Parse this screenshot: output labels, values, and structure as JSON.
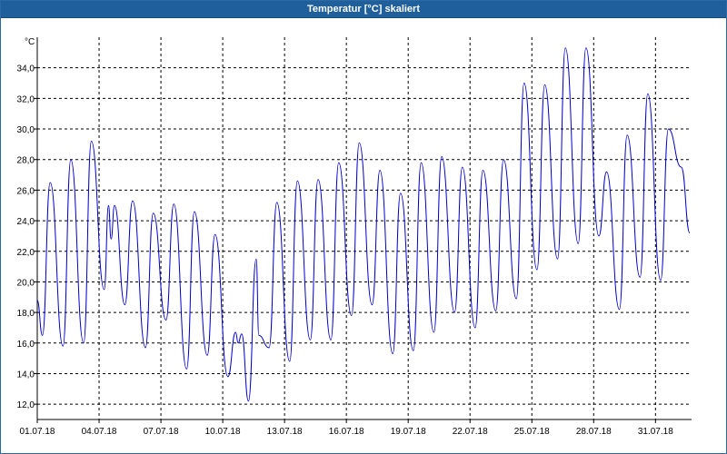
{
  "window": {
    "title": "Temperatur [°C] skaliert"
  },
  "chart_data": {
    "type": "line",
    "title": "Temperatur [°C] skaliert",
    "ylabel": "°C",
    "xlabel": "",
    "xlim": [
      "2018-07-01 00:00",
      "2018-08-01 18:00"
    ],
    "ylim": [
      11.0,
      36.0
    ],
    "grid": true,
    "line_color": "#0000cc",
    "grid_color": "#000000",
    "x_tick_labels": [
      "01.07.18",
      "04.07.18",
      "07.07.18",
      "10.07.18",
      "13.07.18",
      "16.07.18",
      "19.07.18",
      "22.07.18",
      "25.07.18",
      "28.07.18",
      "31.07.18"
    ],
    "y_tick_labels": [
      "12,0",
      "14,0",
      "16,0",
      "18,0",
      "20,0",
      "22,0",
      "24,0",
      "26,0",
      "28,0",
      "30,0",
      "32,0",
      "34,0"
    ],
    "series": [
      {
        "values": [
          [
            "2018-07-01 00:00",
            18.8
          ],
          [
            "2018-07-01 06:00",
            16.5
          ],
          [
            "2018-07-01 15:00",
            26.5
          ],
          [
            "2018-07-02 06:00",
            15.8
          ],
          [
            "2018-07-02 15:00",
            28.0
          ],
          [
            "2018-07-03 06:00",
            16.0
          ],
          [
            "2018-07-03 15:00",
            29.2
          ],
          [
            "2018-07-04 06:00",
            19.5
          ],
          [
            "2018-07-04 11:00",
            25.0
          ],
          [
            "2018-07-04 14:00",
            22.8
          ],
          [
            "2018-07-04 18:00",
            25.0
          ],
          [
            "2018-07-05 06:00",
            18.5
          ],
          [
            "2018-07-05 15:00",
            25.3
          ],
          [
            "2018-07-06 06:00",
            15.7
          ],
          [
            "2018-07-06 15:00",
            24.5
          ],
          [
            "2018-07-07 06:00",
            17.5
          ],
          [
            "2018-07-07 15:00",
            25.1
          ],
          [
            "2018-07-08 06:00",
            14.3
          ],
          [
            "2018-07-08 15:00",
            24.6
          ],
          [
            "2018-07-09 06:00",
            15.2
          ],
          [
            "2018-07-09 15:00",
            23.1
          ],
          [
            "2018-07-10 06:00",
            13.8
          ],
          [
            "2018-07-10 15:00",
            16.7
          ],
          [
            "2018-07-10 18:00",
            16.0
          ],
          [
            "2018-07-10 22:00",
            16.6
          ],
          [
            "2018-07-11 06:00",
            12.2
          ],
          [
            "2018-07-11 15:00",
            21.5
          ],
          [
            "2018-07-11 18:00",
            16.5
          ],
          [
            "2018-07-12 06:00",
            15.7
          ],
          [
            "2018-07-12 15:00",
            25.2
          ],
          [
            "2018-07-13 06:00",
            14.8
          ],
          [
            "2018-07-13 15:00",
            26.6
          ],
          [
            "2018-07-14 06:00",
            16.2
          ],
          [
            "2018-07-14 15:00",
            26.7
          ],
          [
            "2018-07-15 06:00",
            16.2
          ],
          [
            "2018-07-15 15:00",
            27.8
          ],
          [
            "2018-07-16 06:00",
            17.8
          ],
          [
            "2018-07-16 15:00",
            29.1
          ],
          [
            "2018-07-17 06:00",
            18.5
          ],
          [
            "2018-07-17 15:00",
            27.3
          ],
          [
            "2018-07-18 06:00",
            15.3
          ],
          [
            "2018-07-18 15:00",
            25.8
          ],
          [
            "2018-07-19 06:00",
            15.5
          ],
          [
            "2018-07-19 15:00",
            27.8
          ],
          [
            "2018-07-20 06:00",
            16.7
          ],
          [
            "2018-07-20 15:00",
            28.2
          ],
          [
            "2018-07-21 06:00",
            18.0
          ],
          [
            "2018-07-21 15:00",
            27.5
          ],
          [
            "2018-07-22 06:00",
            17.0
          ],
          [
            "2018-07-22 15:00",
            27.3
          ],
          [
            "2018-07-23 06:00",
            18.1
          ],
          [
            "2018-07-23 15:00",
            28.0
          ],
          [
            "2018-07-24 06:00",
            18.9
          ],
          [
            "2018-07-24 15:00",
            33.0
          ],
          [
            "2018-07-25 06:00",
            20.8
          ],
          [
            "2018-07-25 15:00",
            32.9
          ],
          [
            "2018-07-26 06:00",
            21.5
          ],
          [
            "2018-07-26 15:00",
            35.3
          ],
          [
            "2018-07-27 06:00",
            22.5
          ],
          [
            "2018-07-27 15:00",
            35.3
          ],
          [
            "2018-07-28 06:00",
            23.0
          ],
          [
            "2018-07-28 15:00",
            27.2
          ],
          [
            "2018-07-29 06:00",
            18.2
          ],
          [
            "2018-07-29 15:00",
            29.6
          ],
          [
            "2018-07-30 06:00",
            20.3
          ],
          [
            "2018-07-30 15:00",
            32.3
          ],
          [
            "2018-07-31 06:00",
            20.1
          ],
          [
            "2018-07-31 15:00",
            30.0
          ],
          [
            "2018-08-01 06:00",
            27.5
          ],
          [
            "2018-08-01 16:00",
            23.2
          ]
        ]
      }
    ]
  }
}
